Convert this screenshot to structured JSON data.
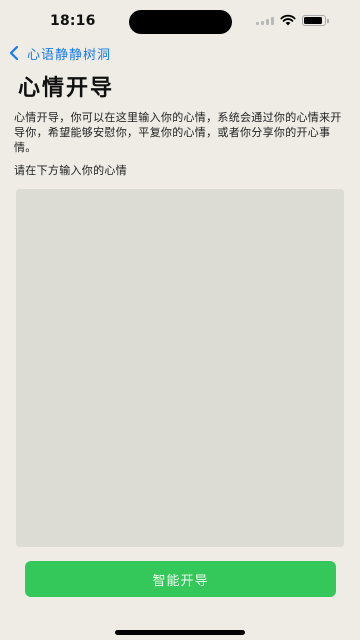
{
  "status_bar": {
    "time": "18:16",
    "icons": [
      "cellular-signal-icon",
      "wifi-icon",
      "battery-icon"
    ]
  },
  "nav": {
    "back_label": "心语静静树洞",
    "back_icon": "chevron-left-icon",
    "accent_color": "#1a7bef"
  },
  "page": {
    "title": "心情开导",
    "description": "心情开导，你可以在这里输入你的心情，系统会通过你的心情来开导你，希望能够安慰你，平复你的心情，或者你分享你的开心事情。",
    "input_prompt": "请在下方输入你的心情",
    "input_value": "",
    "input_placeholder": ""
  },
  "actions": {
    "submit_label": "智能开导",
    "submit_color": "#34c759"
  }
}
